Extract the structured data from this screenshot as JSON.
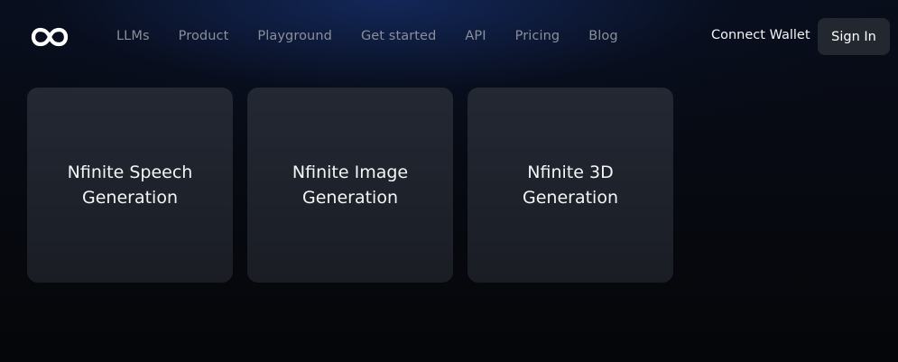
{
  "header": {
    "logo_icon": "infinity-icon",
    "nav": [
      {
        "label": "LLMs"
      },
      {
        "label": "Product"
      },
      {
        "label": "Playground"
      },
      {
        "label": "Get started"
      },
      {
        "label": "API"
      },
      {
        "label": "Pricing"
      },
      {
        "label": "Blog"
      }
    ],
    "connect_wallet_label": "Connect Wallet",
    "sign_in_label": "Sign In"
  },
  "cards": [
    {
      "title": "Nfinite Speech Generation"
    },
    {
      "title": "Nfinite Image Generation"
    },
    {
      "title": "Nfinite 3D Generation"
    }
  ],
  "colors": {
    "background": "#070a12",
    "card": "#20242d",
    "button": "#232830",
    "nav_text": "#8a8f99",
    "text": "#f4f5f7"
  }
}
